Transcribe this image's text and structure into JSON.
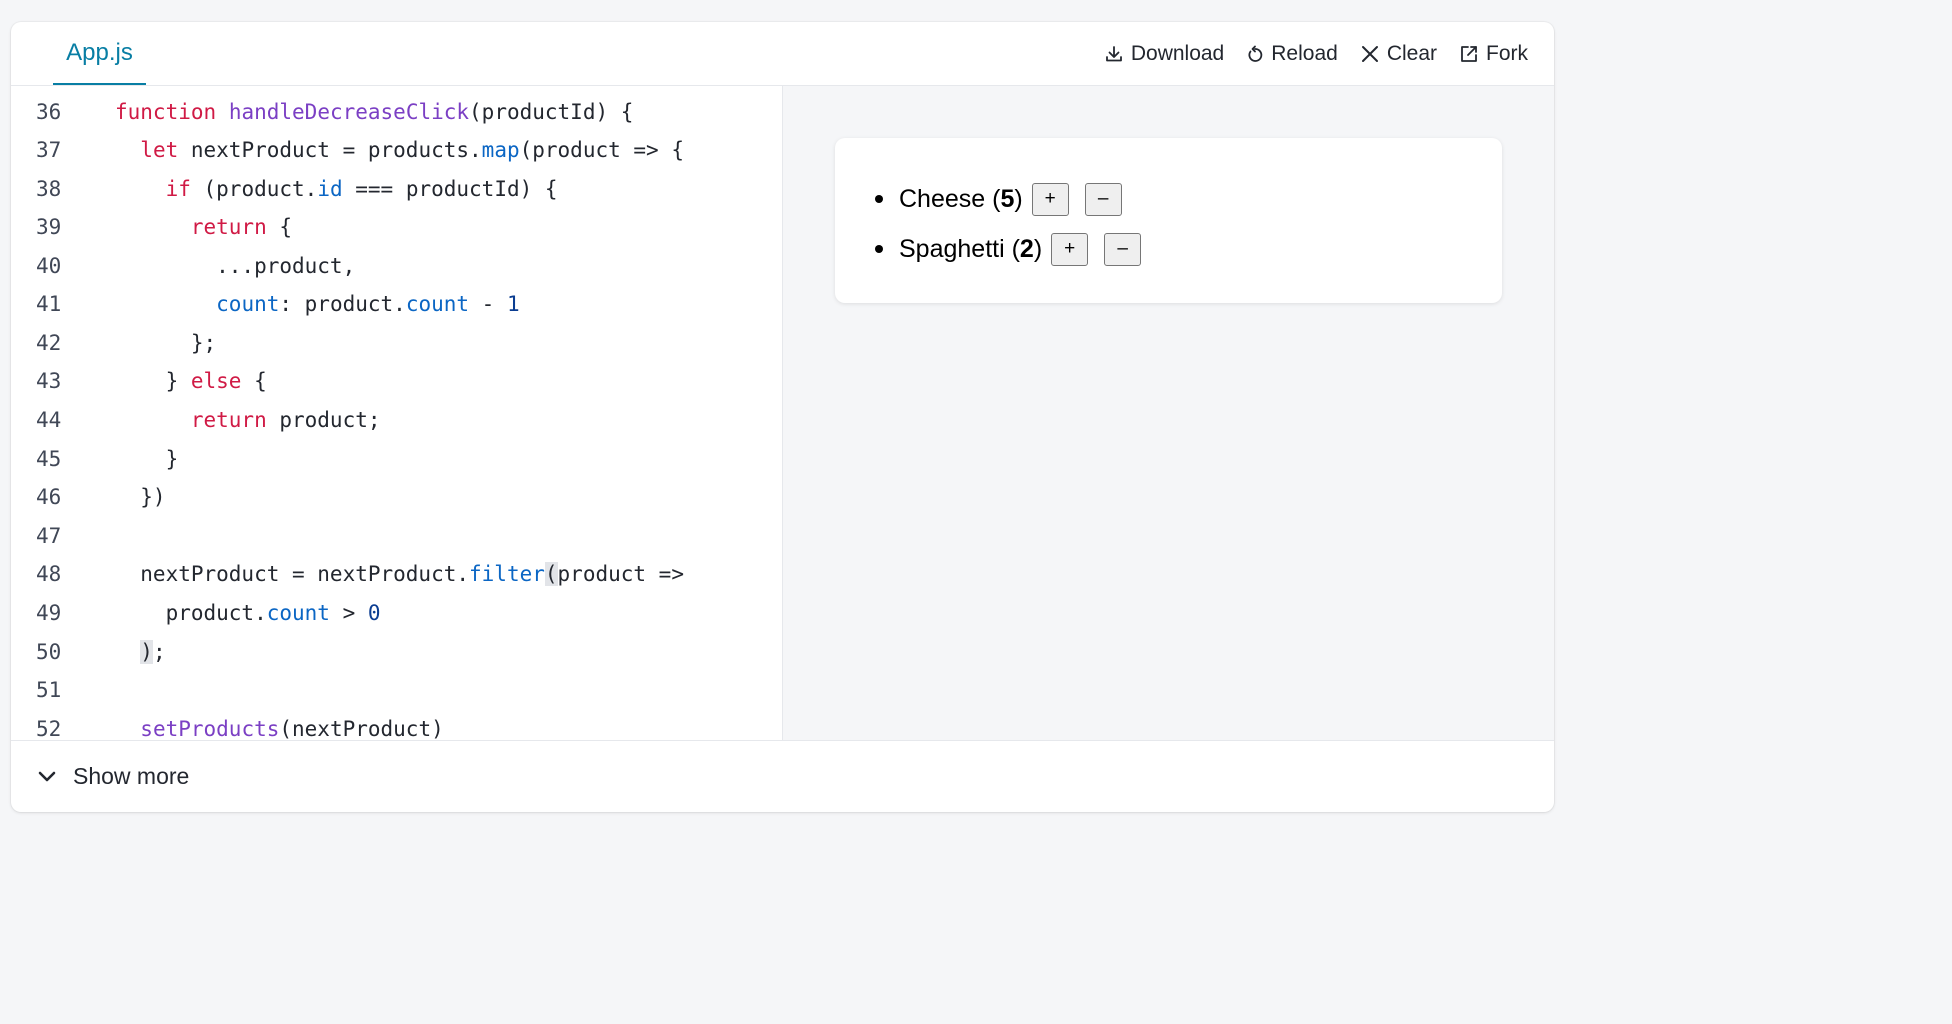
{
  "tab": {
    "label": "App.js"
  },
  "toolbar": {
    "download_label": "Download",
    "reload_label": "Reload",
    "clear_label": "Clear",
    "fork_label": "Fork"
  },
  "code": {
    "lines": [
      {
        "n": "36",
        "text": "function handleDecreaseClick(productId) {"
      },
      {
        "n": "37",
        "text": "  let nextProduct = products.map(product => {"
      },
      {
        "n": "38",
        "text": "    if (product.id === productId) {"
      },
      {
        "n": "39",
        "text": "      return {"
      },
      {
        "n": "40",
        "text": "        ...product,"
      },
      {
        "n": "41",
        "text": "        count: product.count - 1"
      },
      {
        "n": "42",
        "text": "      };"
      },
      {
        "n": "43",
        "text": "    } else {"
      },
      {
        "n": "44",
        "text": "      return product;"
      },
      {
        "n": "45",
        "text": "    }"
      },
      {
        "n": "46",
        "text": "  })"
      },
      {
        "n": "47",
        "text": ""
      },
      {
        "n": "48",
        "text": "  nextProduct = nextProduct.filter(product =>"
      },
      {
        "n": "49",
        "text": "    product.count > 0"
      },
      {
        "n": "50",
        "text": "  );"
      },
      {
        "n": "51",
        "text": ""
      },
      {
        "n": "52",
        "text": "  setProducts(nextProduct)"
      }
    ]
  },
  "preview": {
    "items": [
      {
        "name": "Cheese",
        "count": "5",
        "open": " (",
        "close": ")",
        "plus": "+",
        "minus": "–"
      },
      {
        "name": "Spaghetti",
        "count": "2",
        "open": " (",
        "close": ")",
        "plus": "+",
        "minus": "–"
      }
    ]
  },
  "footer": {
    "show_more_label": "Show more"
  },
  "colors": {
    "accent": "#087ea4",
    "keyword": "#d01a45",
    "function": "#7b3fc4",
    "property": "#0b66c4"
  }
}
